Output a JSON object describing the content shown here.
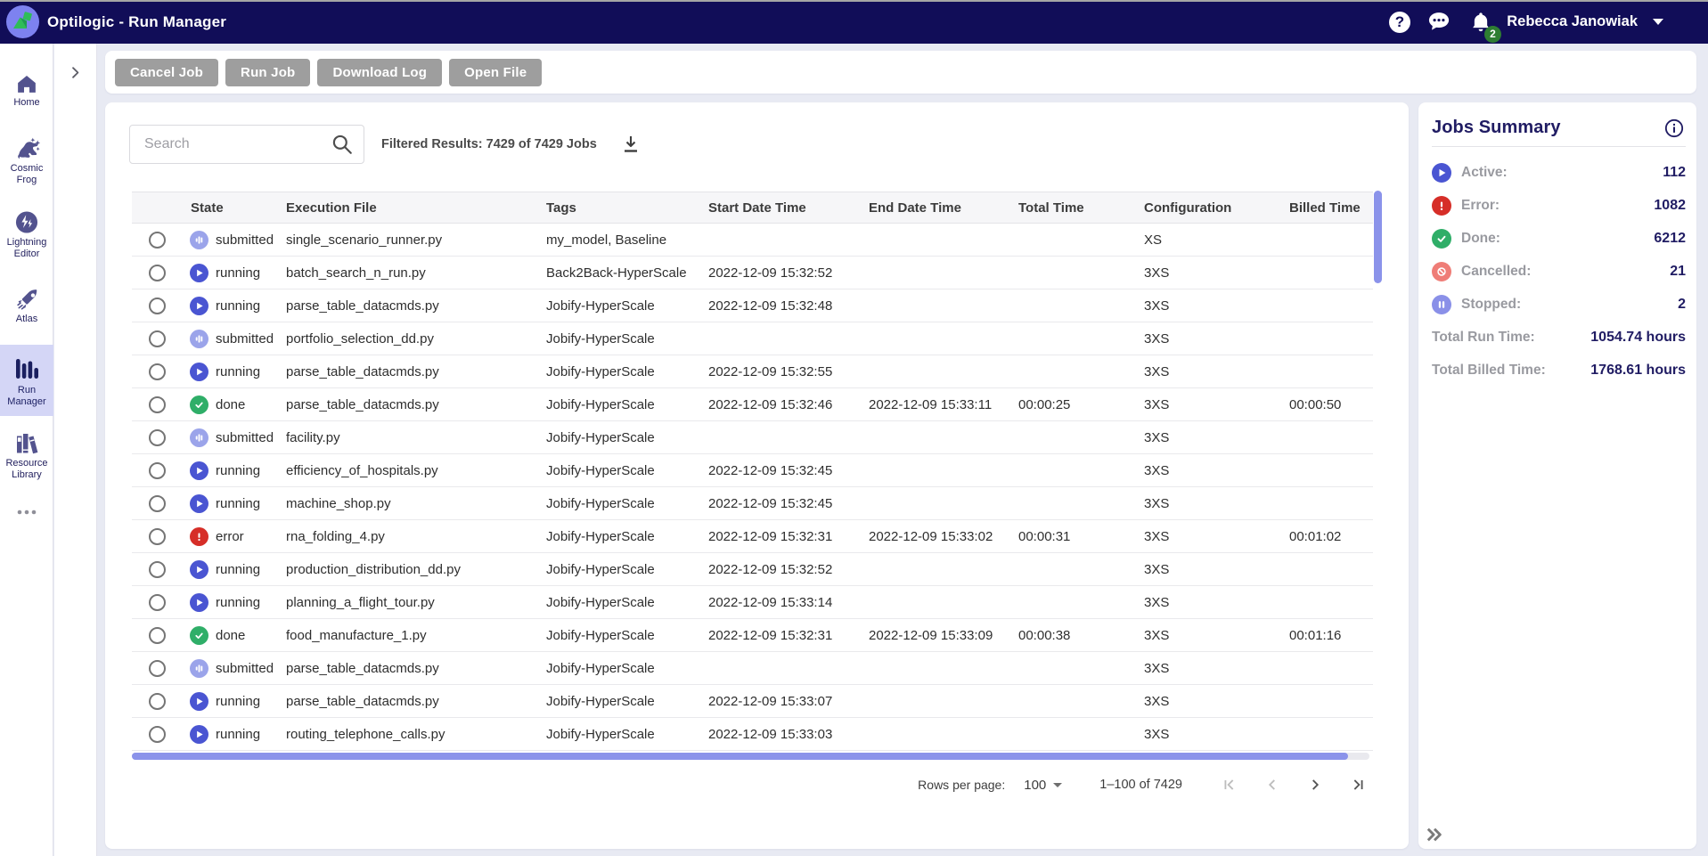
{
  "navbar": {
    "title": "Optilogic - Run Manager",
    "user_name": "Rebecca Janowiak",
    "notification_count": "2",
    "icons": [
      "help-icon",
      "chat-icon",
      "bell-icon"
    ]
  },
  "sidebar": {
    "items": [
      {
        "id": "home",
        "label": "Home",
        "active": false
      },
      {
        "id": "cosmic-frog",
        "label": "Cosmic\nFrog",
        "active": false
      },
      {
        "id": "lightning-editor",
        "label": "Lightning\nEditor",
        "active": false
      },
      {
        "id": "atlas",
        "label": "Atlas",
        "active": false
      },
      {
        "id": "run-manager",
        "label": "Run\nManager",
        "active": true
      },
      {
        "id": "resource-library",
        "label": "Resource\nLibrary",
        "active": false
      },
      {
        "id": "more",
        "label": "",
        "active": false
      }
    ]
  },
  "toolbar": {
    "buttons": [
      "Cancel Job",
      "Run Job",
      "Download Log",
      "Open File"
    ]
  },
  "table": {
    "search_placeholder": "Search",
    "filtered_results": "Filtered Results: 7429 of 7429 Jobs",
    "columns": [
      "State",
      "Execution File",
      "Tags",
      "Start Date Time",
      "End Date Time",
      "Total Time",
      "Configuration",
      "Billed Time"
    ],
    "rows": [
      {
        "state": "submitted",
        "file": "single_scenario_runner.py",
        "tags": "my_model, Baseline",
        "start": "",
        "end": "",
        "total": "",
        "config": "XS",
        "billed": ""
      },
      {
        "state": "running",
        "file": "batch_search_n_run.py",
        "tags": "Back2Back-HyperScale",
        "start": "2022-12-09 15:32:52",
        "end": "",
        "total": "",
        "config": "3XS",
        "billed": ""
      },
      {
        "state": "running",
        "file": "parse_table_datacmds.py",
        "tags": "Jobify-HyperScale",
        "start": "2022-12-09 15:32:48",
        "end": "",
        "total": "",
        "config": "3XS",
        "billed": ""
      },
      {
        "state": "submitted",
        "file": "portfolio_selection_dd.py",
        "tags": "Jobify-HyperScale",
        "start": "",
        "end": "",
        "total": "",
        "config": "3XS",
        "billed": ""
      },
      {
        "state": "running",
        "file": "parse_table_datacmds.py",
        "tags": "Jobify-HyperScale",
        "start": "2022-12-09 15:32:55",
        "end": "",
        "total": "",
        "config": "3XS",
        "billed": ""
      },
      {
        "state": "done",
        "file": "parse_table_datacmds.py",
        "tags": "Jobify-HyperScale",
        "start": "2022-12-09 15:32:46",
        "end": "2022-12-09 15:33:11",
        "total": "00:00:25",
        "config": "3XS",
        "billed": "00:00:50"
      },
      {
        "state": "submitted",
        "file": "facility.py",
        "tags": "Jobify-HyperScale",
        "start": "",
        "end": "",
        "total": "",
        "config": "3XS",
        "billed": ""
      },
      {
        "state": "running",
        "file": "efficiency_of_hospitals.py",
        "tags": "Jobify-HyperScale",
        "start": "2022-12-09 15:32:45",
        "end": "",
        "total": "",
        "config": "3XS",
        "billed": ""
      },
      {
        "state": "running",
        "file": "machine_shop.py",
        "tags": "Jobify-HyperScale",
        "start": "2022-12-09 15:32:45",
        "end": "",
        "total": "",
        "config": "3XS",
        "billed": ""
      },
      {
        "state": "error",
        "file": "rna_folding_4.py",
        "tags": "Jobify-HyperScale",
        "start": "2022-12-09 15:32:31",
        "end": "2022-12-09 15:33:02",
        "total": "00:00:31",
        "config": "3XS",
        "billed": "00:01:02"
      },
      {
        "state": "running",
        "file": "production_distribution_dd.py",
        "tags": "Jobify-HyperScale",
        "start": "2022-12-09 15:32:52",
        "end": "",
        "total": "",
        "config": "3XS",
        "billed": ""
      },
      {
        "state": "running",
        "file": "planning_a_flight_tour.py",
        "tags": "Jobify-HyperScale",
        "start": "2022-12-09 15:33:14",
        "end": "",
        "total": "",
        "config": "3XS",
        "billed": ""
      },
      {
        "state": "done",
        "file": "food_manufacture_1.py",
        "tags": "Jobify-HyperScale",
        "start": "2022-12-09 15:32:31",
        "end": "2022-12-09 15:33:09",
        "total": "00:00:38",
        "config": "3XS",
        "billed": "00:01:16"
      },
      {
        "state": "submitted",
        "file": "parse_table_datacmds.py",
        "tags": "Jobify-HyperScale",
        "start": "",
        "end": "",
        "total": "",
        "config": "3XS",
        "billed": ""
      },
      {
        "state": "running",
        "file": "parse_table_datacmds.py",
        "tags": "Jobify-HyperScale",
        "start": "2022-12-09 15:33:07",
        "end": "",
        "total": "",
        "config": "3XS",
        "billed": ""
      },
      {
        "state": "running",
        "file": "routing_telephone_calls.py",
        "tags": "Jobify-HyperScale",
        "start": "2022-12-09 15:33:03",
        "end": "",
        "total": "",
        "config": "3XS",
        "billed": ""
      }
    ],
    "pagination": {
      "rows_per_page_label": "Rows per page:",
      "rows_per_page": "100",
      "range": "1–100 of 7429"
    }
  },
  "summary": {
    "title": "Jobs Summary",
    "stats": [
      {
        "icon": "running",
        "label": "Active:",
        "value": "112"
      },
      {
        "icon": "error",
        "label": "Error:",
        "value": "1082"
      },
      {
        "icon": "done",
        "label": "Done:",
        "value": "6212"
      },
      {
        "icon": "cancelled",
        "label": "Cancelled:",
        "value": "21"
      },
      {
        "icon": "stopped",
        "label": "Stopped:",
        "value": "2"
      }
    ],
    "totals": [
      {
        "label": "Total Run Time:",
        "value": "1054.74 hours"
      },
      {
        "label": "Total Billed Time:",
        "value": "1768.61 hours"
      }
    ]
  },
  "colors": {
    "navbar": "#110d58",
    "accent_periwinkle": "#8b93ea",
    "running": "#4a55d2",
    "submitted": "#9ba4ea",
    "done": "#2fae68",
    "error": "#d62e28",
    "cancelled": "#ef7d77",
    "stopped": "#8a90e8",
    "badge_green": "#2e7d32",
    "disabled_button": "#9e9e9e"
  }
}
